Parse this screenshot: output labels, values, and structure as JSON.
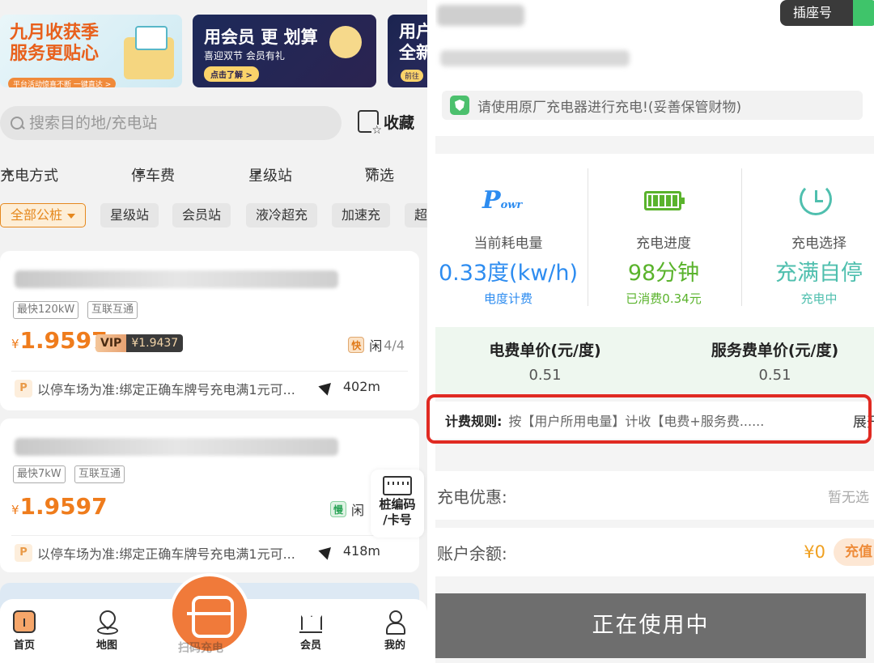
{
  "left": {
    "banners": [
      {
        "title_line1": "九月收获季",
        "title_line2": "服务更贴心",
        "pill": "平台活动惊喜不断 一键直达 >"
      },
      {
        "title": "用会员 更 划算",
        "subtitle": "喜迎双节 会员有礼",
        "pill": "点击了解 >"
      },
      {
        "title_line1": "用户",
        "title_line2": "全新",
        "pill": "前往"
      }
    ],
    "search": {
      "placeholder": "搜索目的地/充电站"
    },
    "favorite_label": "收藏",
    "filters": [
      "充电方式",
      "停车费",
      "星级站",
      "筛选"
    ],
    "chips": [
      "全部公桩",
      "星级站",
      "会员站",
      "液冷超充",
      "加速充",
      "超"
    ],
    "stations": [
      {
        "tags": [
          "最快120kW",
          "互联互通"
        ],
        "currency": "¥",
        "price": "1.9597",
        "vip_label": "VIP",
        "vip_price": "¥1.9437",
        "speed_badge": "快",
        "idle_label": "闲",
        "idle_count": "4/4",
        "parking_badge": "P",
        "parking_text": "以停车场为准:绑定正确车牌号充电满1元可...",
        "distance": "402m"
      },
      {
        "tags": [
          "最快7kW",
          "互联互通"
        ],
        "currency": "¥",
        "price": "1.9597",
        "speed_badge": "慢",
        "idle_label": "闲",
        "parking_badge": "P",
        "parking_text": "以停车场为准:绑定正确车牌号充电满1元可...",
        "distance": "418m"
      }
    ],
    "keypad": {
      "line1": "桩编码",
      "line2": "/卡号"
    },
    "tabs": [
      "首页",
      "地图",
      "会员",
      "我的"
    ],
    "scan_label": "扫码充电"
  },
  "right": {
    "socket_label": "插座号",
    "notice": "请使用原厂充电器进行充电!(妥善保管财物)",
    "stats": [
      {
        "icon_text": "Powr",
        "label": "当前耗电量",
        "value": "0.33度(kw/h)",
        "sub": "电度计费",
        "color": "#2d8cf0"
      },
      {
        "label": "充电进度",
        "value": "98分钟",
        "sub": "已消费0.34元",
        "color": "#5ab32c"
      },
      {
        "label": "充电选择",
        "value": "充满自停",
        "sub": "充电中",
        "color": "#4fbfae"
      }
    ],
    "prices": [
      {
        "header": "电费单价(元/度)",
        "value": "0.51"
      },
      {
        "header": "服务费单价(元/度)",
        "value": "0.51"
      }
    ],
    "rule": {
      "label": "计费规则:",
      "text": "按【用户所用电量】计收【电费+服务费......",
      "expand": "展开"
    },
    "discount": {
      "label": "充电优惠:",
      "value": "暂无选"
    },
    "balance": {
      "label": "账户余额:",
      "value": "¥0",
      "charge": "充值"
    },
    "use_button": "正在使用中"
  }
}
